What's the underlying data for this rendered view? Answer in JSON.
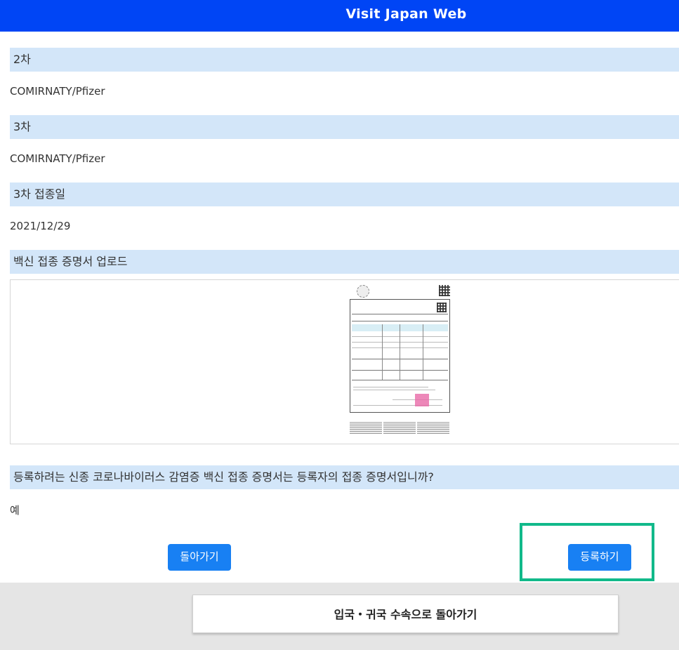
{
  "header": {
    "title": "Visit Japan Web"
  },
  "sections": [
    {
      "heading": "2차",
      "value": "COMIRNATY/Pfizer"
    },
    {
      "heading": "3차",
      "value": "COMIRNATY/Pfizer"
    },
    {
      "heading": "3차 접종일",
      "value": "2021/12/29"
    }
  ],
  "upload": {
    "heading": "백신 접종 증명서 업로드"
  },
  "confirm": {
    "question": "등록하려는 신종 코로나바이러스 감염증 백신 접종 증명서는 등록자의 접종 증명서입니까?",
    "answer": "예"
  },
  "buttons": {
    "back": "돌아가기",
    "register": "등록하기"
  },
  "footer": {
    "back_to_procedures": "입국・귀국 수속으로 돌아가기"
  },
  "colors": {
    "header_bg": "#0045f5",
    "section_bg": "#d3e6f9",
    "button_bg": "#1880f3",
    "highlight": "#11b98a"
  }
}
